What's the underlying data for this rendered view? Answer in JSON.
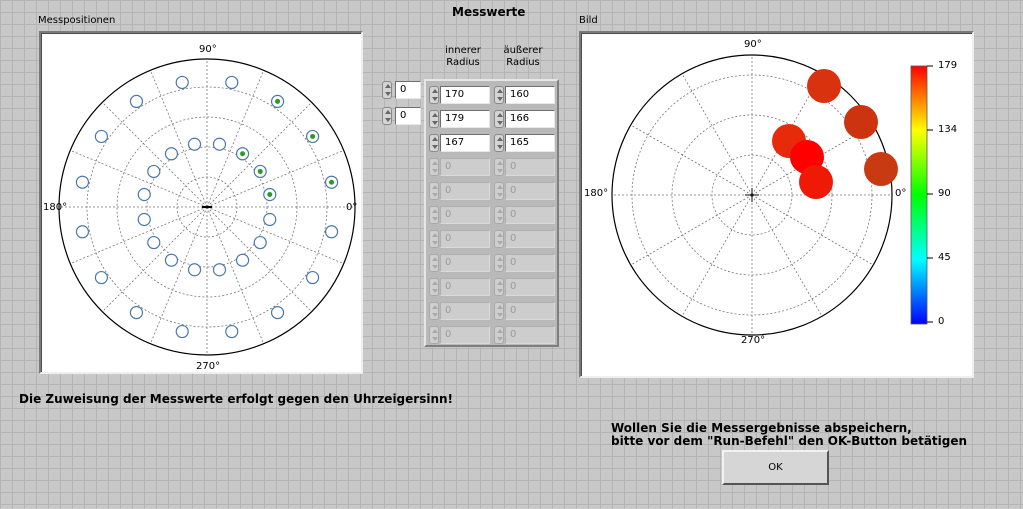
{
  "header": {
    "messpositionen_label": "Messpositionen",
    "messwerte_title": "Messwerte",
    "bild_label": "Bild"
  },
  "polar_left": {
    "labels": {
      "deg90": "90°",
      "deg180": "180°",
      "deg0": "0°",
      "deg270": "270°"
    },
    "marker_color_highlight": "#2a9a2a",
    "marker_color_outline": "#4a78a8"
  },
  "index_controls": [
    "0",
    "0"
  ],
  "table": {
    "col_inner": "innerer Radius",
    "col_outer": "äußerer Radius",
    "rows": [
      {
        "inner": "170",
        "outer": "160",
        "enabled": true
      },
      {
        "inner": "179",
        "outer": "166",
        "enabled": true
      },
      {
        "inner": "167",
        "outer": "165",
        "enabled": true
      },
      {
        "inner": "0",
        "outer": "0",
        "enabled": false
      },
      {
        "inner": "0",
        "outer": "0",
        "enabled": false
      },
      {
        "inner": "0",
        "outer": "0",
        "enabled": false
      },
      {
        "inner": "0",
        "outer": "0",
        "enabled": false
      },
      {
        "inner": "0",
        "outer": "0",
        "enabled": false
      },
      {
        "inner": "0",
        "outer": "0",
        "enabled": false
      },
      {
        "inner": "0",
        "outer": "0",
        "enabled": false
      },
      {
        "inner": "0",
        "outer": "0",
        "enabled": false
      }
    ]
  },
  "polar_right": {
    "labels": {
      "deg90": "90°",
      "deg180": "180°",
      "deg0": "0°",
      "deg270": "270°"
    },
    "colorbar_ticks": [
      "179",
      "134",
      "90",
      "45",
      "0"
    ],
    "colorbar_colors": [
      "#ff0000",
      "#ffff00",
      "#00ff00",
      "#00ffff",
      "#0000ff"
    ]
  },
  "messages": {
    "direction": "Die Zuweisung der Messwerte erfolgt gegen den Uhrzeigersinn!",
    "save_line1": "Wollen Sie die Messergebnisse abspeichern,",
    "save_line2": "bitte vor dem \"Run-Befehl\" den OK-Button betätigen"
  },
  "ok_button": {
    "label": "OK"
  }
}
